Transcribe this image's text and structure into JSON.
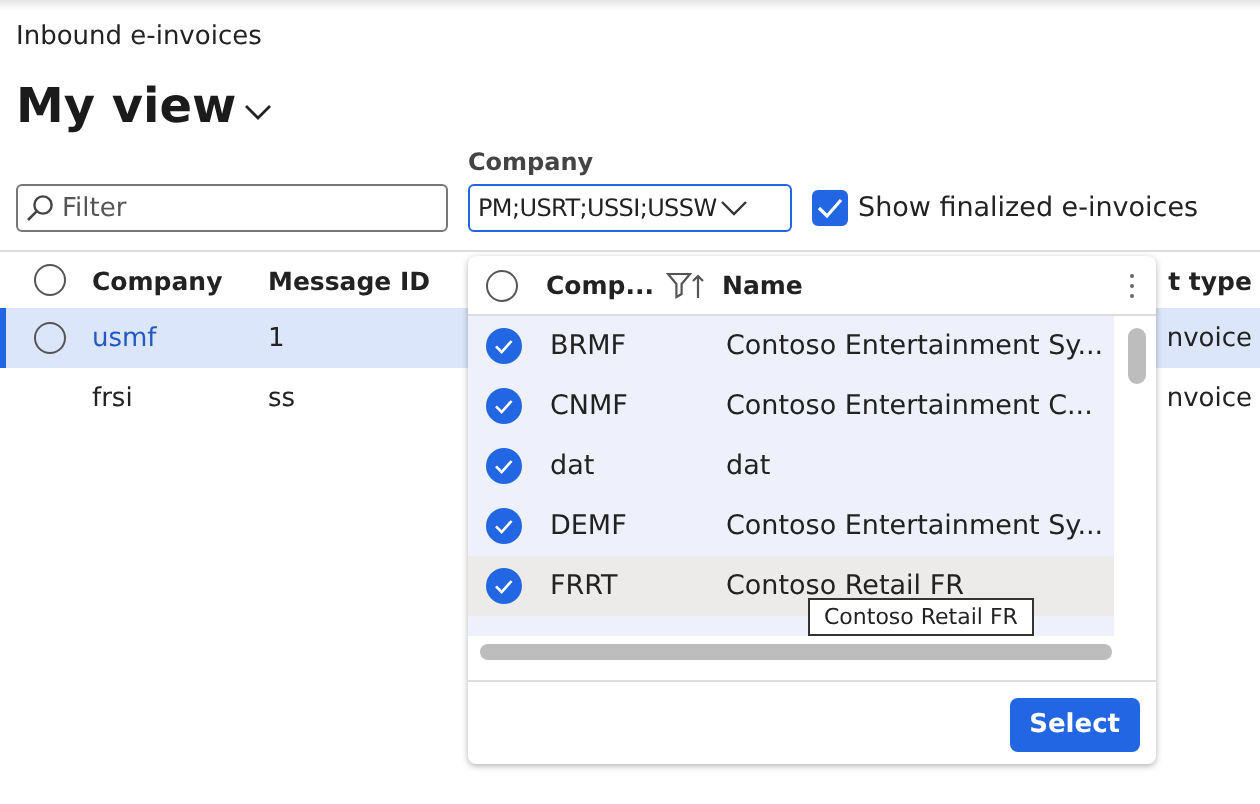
{
  "page": {
    "breadcrumb": "Inbound e-invoices",
    "view_title": "My view"
  },
  "filter": {
    "placeholder": "Filter"
  },
  "company_field": {
    "label": "Company",
    "value": "PM;USRT;USSI;USSW"
  },
  "show_finalized": {
    "label": "Show finalized e-invoices",
    "checked": true
  },
  "grid": {
    "all_selected": false,
    "columns": [
      "Company",
      "Message ID",
      "t type"
    ],
    "rows": [
      {
        "company": "usmf",
        "message_id": "1",
        "column_3": "nvoice",
        "selected": true
      },
      {
        "company": "frsi",
        "message_id": "ss",
        "column_3": "nvoice",
        "selected": false
      }
    ]
  },
  "lookup": {
    "all_selected": false,
    "columns": [
      "Comp...",
      "Name"
    ],
    "rows": [
      {
        "code": "BRMF",
        "name": "Contoso Entertainment Sy...",
        "selected": true,
        "hovered": false
      },
      {
        "code": "CNMF",
        "name": "Contoso Entertainment C...",
        "selected": true,
        "hovered": false
      },
      {
        "code": "dat",
        "name": "dat",
        "selected": true,
        "hovered": false
      },
      {
        "code": "DEMF",
        "name": "Contoso Entertainment Sy...",
        "selected": true,
        "hovered": false
      },
      {
        "code": "FRRT",
        "name": "Contoso Retail FR",
        "selected": true,
        "hovered": true
      }
    ],
    "tooltip": "Contoso Retail FR",
    "button": "Select"
  }
}
